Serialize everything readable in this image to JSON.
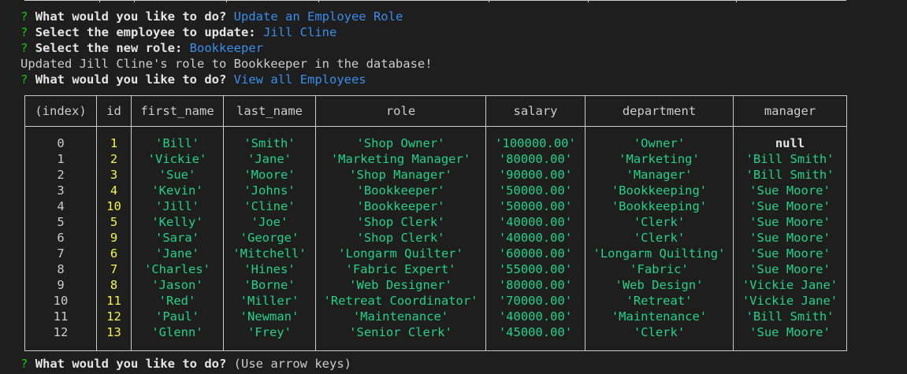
{
  "prompts": [
    {
      "marker": "?",
      "question": "What would you like to do?",
      "answer": "Update an Employee Role"
    },
    {
      "marker": "?",
      "question": "Select the employee to update:",
      "answer": "Jill Cline"
    },
    {
      "marker": "?",
      "question": "Select the new role:",
      "answer": "Bookkeeper"
    },
    {
      "marker": "?",
      "question": "What would you like to do?",
      "answer": "View all Employees"
    },
    {
      "marker": "?",
      "question": "What would you like to do?",
      "hint": "(Use arrow keys)"
    }
  ],
  "status_message": "Updated Jill Cline's role to Bookkeeper in the database!",
  "colors": {
    "background": "#1e1e1e",
    "prompt_marker": "#16c60c",
    "answer": "#3b8eea",
    "number": "#f5f543",
    "string": "#23d18b",
    "text": "#cccccc"
  },
  "table": {
    "columns": [
      "(index)",
      "id",
      "first_name",
      "last_name",
      "role",
      "salary",
      "department",
      "manager"
    ],
    "rows": [
      [
        "0",
        "1",
        "'Bill'",
        "'Smith'",
        "'Shop Owner'",
        "'100000.00'",
        "'Owner'",
        "null"
      ],
      [
        "1",
        "2",
        "'Vickie'",
        "'Jane'",
        "'Marketing Manager'",
        "'80000.00'",
        "'Marketing'",
        "'Bill Smith'"
      ],
      [
        "2",
        "3",
        "'Sue'",
        "'Moore'",
        "'Shop Manager'",
        "'90000.00'",
        "'Manager'",
        "'Bill Smith'"
      ],
      [
        "3",
        "4",
        "'Kevin'",
        "'Johns'",
        "'Bookkeeper'",
        "'50000.00'",
        "'Bookkeeping'",
        "'Sue Moore'"
      ],
      [
        "4",
        "10",
        "'Jill'",
        "'Cline'",
        "'Bookkeeper'",
        "'50000.00'",
        "'Bookkeeping'",
        "'Sue Moore'"
      ],
      [
        "5",
        "5",
        "'Kelly'",
        "'Joe'",
        "'Shop Clerk'",
        "'40000.00'",
        "'Clerk'",
        "'Sue Moore'"
      ],
      [
        "6",
        "9",
        "'Sara'",
        "'George'",
        "'Shop Clerk'",
        "'40000.00'",
        "'Clerk'",
        "'Sue Moore'"
      ],
      [
        "7",
        "6",
        "'Jane'",
        "'Mitchell'",
        "'Longarm Quilter'",
        "'60000.00'",
        "'Longarm Quilting'",
        "'Sue Moore'"
      ],
      [
        "8",
        "7",
        "'Charles'",
        "'Hines'",
        "'Fabric Expert'",
        "'55000.00'",
        "'Fabric'",
        "'Sue Moore'"
      ],
      [
        "9",
        "8",
        "'Jason'",
        "'Borne'",
        "'Web Designer'",
        "'80000.00'",
        "'Web Design'",
        "'Vickie Jane'"
      ],
      [
        "10",
        "11",
        "'Red'",
        "'Miller'",
        "'Retreat Coordinator'",
        "'70000.00'",
        "'Retreat'",
        "'Vickie Jane'"
      ],
      [
        "11",
        "12",
        "'Paul'",
        "'Newman'",
        "'Maintenance'",
        "'40000.00'",
        "'Maintenance'",
        "'Bill Smith'"
      ],
      [
        "12",
        "13",
        "'Glenn'",
        "'Frey'",
        "'Senior Clerk'",
        "'45000.00'",
        "'Clerk'",
        "'Sue Moore'"
      ]
    ]
  }
}
